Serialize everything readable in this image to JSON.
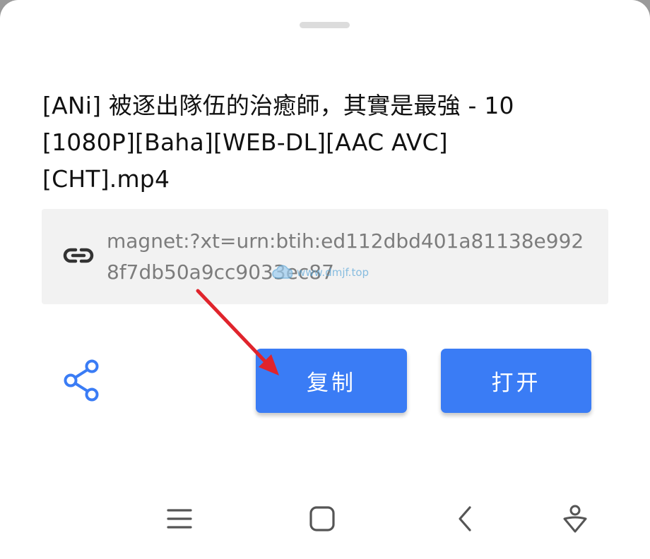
{
  "file": {
    "name": "[ANi] 被逐出隊伍的治癒師，其實是最強 - 10 [1080P][Baha][WEB-DL][AAC AVC][CHT].mp4"
  },
  "magnet": {
    "link": "magnet:?xt=urn:btih:ed112dbd401a81138e9928f7db50a9cc9033ec87",
    "icon": "link-icon"
  },
  "watermark": {
    "text": "www.dmjf.top"
  },
  "actions": {
    "share_icon": "share-icon",
    "copy_label": "复制",
    "open_label": "打开"
  },
  "nav": {
    "items": [
      "menu-icon",
      "home-icon",
      "back-icon",
      "assistant-icon"
    ]
  },
  "colors": {
    "accent": "#3a7cf5",
    "arrow": "#e0242c",
    "link_text": "#7c7c7c"
  }
}
